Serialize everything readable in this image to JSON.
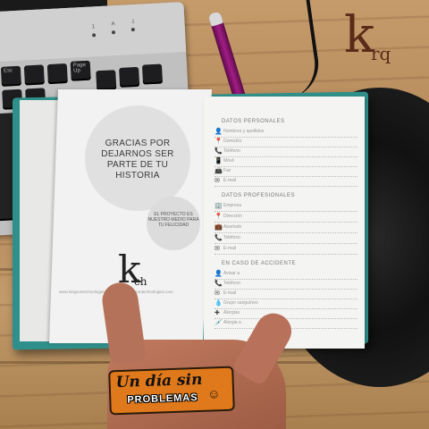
{
  "scene": {
    "brand_logo": {
      "mark": "k",
      "text": "rq"
    },
    "keyboard": {
      "led_labels": [
        "1",
        "A",
        "⇩"
      ],
      "keys": [
        "Esc",
        "",
        "",
        "Page Up",
        "",
        "",
        "",
        "",
        ""
      ]
    },
    "notebook": {
      "left_page": {
        "thanks_text": "GRACIAS POR DEJARNOS SER PARTE DE TU HISTORIA",
        "slogan_text": "EL PROYECTO ES NUESTRO MEDIO PARA TU FELICIDAD",
        "logo": {
          "mark": "k",
          "text": "ch"
        },
        "fine_print": "www.kingsontechnologies.com  ·  info@kingsontechnologies.com"
      },
      "right_page": {
        "personal_title": "DATOS PERSONALES",
        "personal_rows": [
          {
            "icon": "person-icon",
            "glyph": "👤",
            "label": "Nombres y apellidos"
          },
          {
            "icon": "location-icon",
            "glyph": "📍",
            "label": "Domicilio"
          },
          {
            "icon": "phone-icon",
            "glyph": "📞",
            "label": "Teléfono"
          },
          {
            "icon": "mobile-icon",
            "glyph": "📱",
            "label": "Móvil"
          },
          {
            "icon": "fax-icon",
            "glyph": "📠",
            "label": "Fax"
          },
          {
            "icon": "email-icon",
            "glyph": "✉",
            "label": "E-mail"
          }
        ],
        "professional_title": "DATOS PROFESIONALES",
        "professional_rows": [
          {
            "icon": "building-icon",
            "glyph": "🏢",
            "label": "Empresa"
          },
          {
            "icon": "location-icon",
            "glyph": "📍",
            "label": "Dirección"
          },
          {
            "icon": "briefcase-icon",
            "glyph": "💼",
            "label": "Apartado"
          },
          {
            "icon": "phone-icon",
            "glyph": "📞",
            "label": "Teléfono"
          },
          {
            "icon": "email-icon",
            "glyph": "✉",
            "label": "E-mail"
          }
        ],
        "emergency_title": "EN CASO DE ACCIDENTE",
        "emergency_rows": [
          {
            "icon": "person-icon",
            "glyph": "👤",
            "label": "Avisar a"
          },
          {
            "icon": "phone-icon",
            "glyph": "📞",
            "label": "Teléfono"
          },
          {
            "icon": "email-icon",
            "glyph": "✉",
            "label": "E-mail"
          },
          {
            "icon": "blood-drop-icon",
            "glyph": "💧",
            "label": "Grupo sanguíneo"
          },
          {
            "icon": "allergy-icon",
            "glyph": "✚",
            "label": "Alergias"
          },
          {
            "icon": "syringe-icon",
            "glyph": "💉",
            "label": "Alergia a"
          }
        ]
      }
    },
    "sticker": {
      "line1": "Un día sin",
      "line2": "PROBLEMAS",
      "smile": "☺"
    }
  }
}
